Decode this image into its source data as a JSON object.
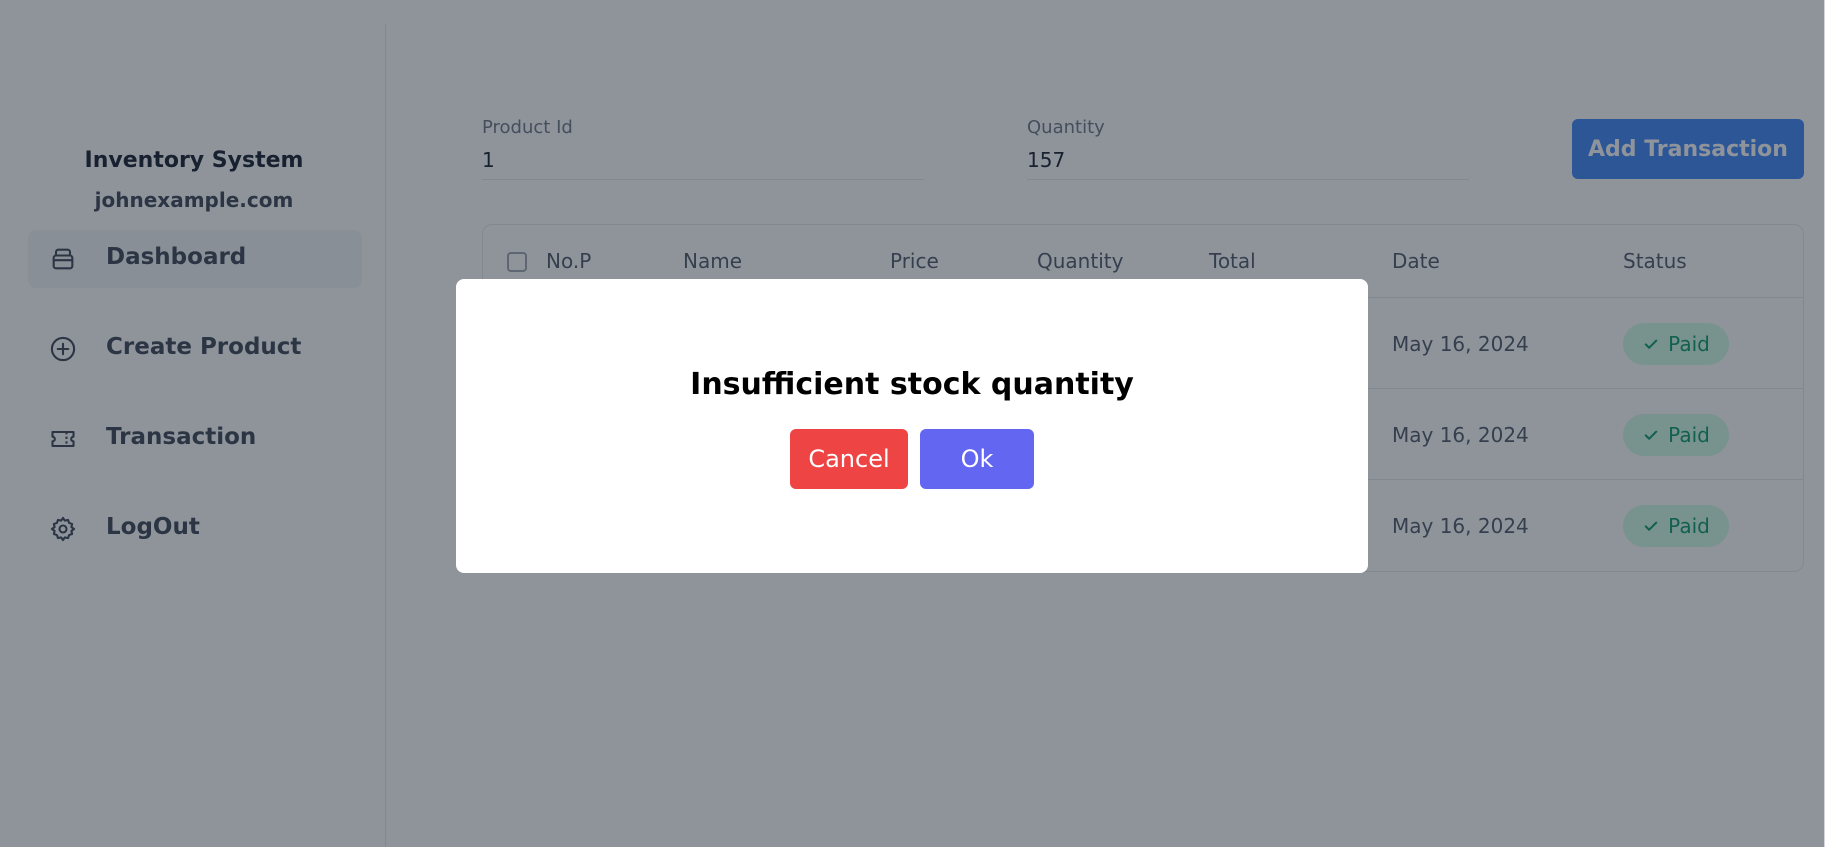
{
  "sidebar": {
    "title": "Inventory System",
    "email": "johnexample.com",
    "items": [
      {
        "label": "Dashboard",
        "icon": "wallet-icon"
      },
      {
        "label": "Create Product",
        "icon": "plus-circle-icon"
      },
      {
        "label": "Transaction",
        "icon": "ticket-icon"
      },
      {
        "label": "LogOut",
        "icon": "gear-icon"
      }
    ]
  },
  "form": {
    "product_id_label": "Product Id",
    "product_id_value": "1",
    "quantity_label": "Quantity",
    "quantity_value": "157",
    "add_button": "Add Transaction"
  },
  "table": {
    "headers": [
      "No.P",
      "Name",
      "Price",
      "Quantity",
      "Total",
      "Date",
      "Status"
    ],
    "rows": [
      {
        "date": "May 16, 2024",
        "status": "Paid"
      },
      {
        "date": "May 16, 2024",
        "status": "Paid"
      },
      {
        "date": "May 16, 2024",
        "status": "Paid"
      }
    ]
  },
  "modal": {
    "title": "Insufficient stock quantity",
    "cancel": "Cancel",
    "ok": "Ok"
  },
  "colors": {
    "primary": "#3b82f6",
    "danger": "#ef4444",
    "indigo": "#6366f1",
    "success": "#059669"
  }
}
